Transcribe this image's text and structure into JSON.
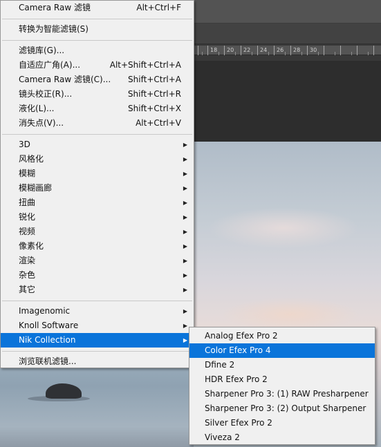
{
  "filter_menu": {
    "items": [
      {
        "label": "Camera Raw 滤镜",
        "shortcut": "Alt+Ctrl+F"
      },
      {
        "label": "转换为智能滤镜(S)"
      },
      {
        "label": "滤镜库(G)..."
      },
      {
        "label": "自适应广角(A)...",
        "shortcut": "Alt+Shift+Ctrl+A"
      },
      {
        "label": "Camera Raw 滤镜(C)...",
        "shortcut": "Shift+Ctrl+A"
      },
      {
        "label": "镜头校正(R)...",
        "shortcut": "Shift+Ctrl+R"
      },
      {
        "label": "液化(L)...",
        "shortcut": "Shift+Ctrl+X"
      },
      {
        "label": "消失点(V)...",
        "shortcut": "Alt+Ctrl+V"
      },
      {
        "label": "3D"
      },
      {
        "label": "风格化"
      },
      {
        "label": "模糊"
      },
      {
        "label": "模糊画廊"
      },
      {
        "label": "扭曲"
      },
      {
        "label": "锐化"
      },
      {
        "label": "视频"
      },
      {
        "label": "像素化"
      },
      {
        "label": "渲染"
      },
      {
        "label": "杂色"
      },
      {
        "label": "其它"
      },
      {
        "label": "Imagenomic"
      },
      {
        "label": "Knoll Software"
      },
      {
        "label": "Nik Collection"
      },
      {
        "label": "浏览联机滤镜..."
      }
    ]
  },
  "nik_submenu": {
    "items": [
      {
        "label": "Analog Efex Pro 2"
      },
      {
        "label": "Color Efex Pro 4"
      },
      {
        "label": "Dfine 2"
      },
      {
        "label": "HDR Efex Pro 2"
      },
      {
        "label": "Sharpener Pro 3: (1) RAW Presharpener"
      },
      {
        "label": "Sharpener Pro 3: (2) Output Sharpener"
      },
      {
        "label": "Silver Efex Pro 2"
      },
      {
        "label": "Viveza 2"
      }
    ]
  },
  "ruler": {
    "labels": [
      "18",
      "20",
      "22",
      "24",
      "26",
      "28",
      "30"
    ]
  },
  "icons": {
    "submenu_arrow": "▶"
  },
  "colors": {
    "highlight": "#0a74da",
    "menu_bg": "#f0f0f0"
  }
}
